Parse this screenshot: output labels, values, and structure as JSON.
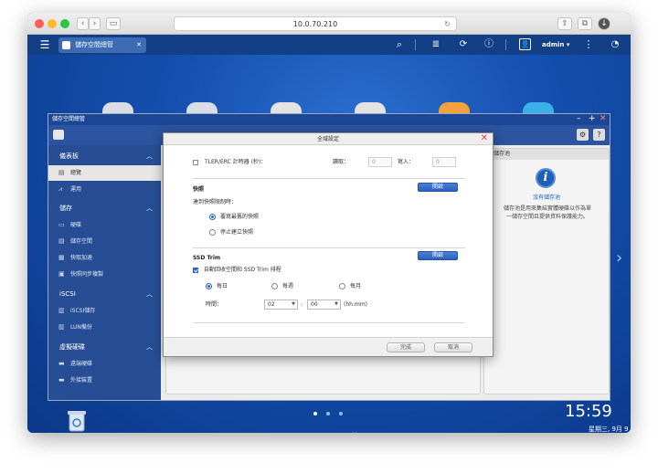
{
  "browser": {
    "url": "10.0.70.210"
  },
  "qts_toolbar": {
    "tab_label": "儲存空間總管",
    "user": "admin ▾"
  },
  "storage_manager": {
    "window_title": "儲存空間總管",
    "sidebar": {
      "sections": [
        {
          "label": "儀表板",
          "items": [
            "總覽",
            "運用"
          ]
        },
        {
          "label": "儲存",
          "items": [
            "硬碟",
            "儲存空間",
            "快取加速",
            "快照同步複製"
          ]
        },
        {
          "label": "iSCSI",
          "items": [
            "iSCSI儲存",
            "LUN備份"
          ]
        },
        {
          "label": "虛擬硬碟",
          "items": [
            "遠端硬碟",
            "外接裝置"
          ]
        }
      ],
      "active_item": "總覽"
    },
    "right_panel": {
      "header": "儲存池",
      "no_pool": "沒有儲存池",
      "info_line1": "儲存池是用來集結實體硬碟以作為單",
      "info_line2": "一儲存空間且提供資料保護能力。"
    }
  },
  "dialog": {
    "title": "全域設定",
    "tler_label": "TLER/ERC 計時器 (秒)：",
    "read_label": "讀取：",
    "write_label": "寫入：",
    "read_value": "0",
    "write_value": "0",
    "snapshot": {
      "heading": "快照",
      "status_button": "開啟",
      "limit_label": "達到快照限制時：",
      "option_overwrite": "覆寫最舊的快照",
      "option_stop": "停止建立快照"
    },
    "ssd_trim": {
      "heading": "SSD Trim",
      "status_button": "開啟",
      "auto_label": "自動回收空間和 SSD Trim 排程",
      "daily": "每日",
      "weekly": "每週",
      "monthly": "每月",
      "time_label": "時間：",
      "hour": "02",
      "minute": "00",
      "colon": ":",
      "format": "(hh:mm)"
    },
    "buttons": {
      "finish": "完成",
      "cancel": "取消"
    }
  },
  "desktop": {
    "time": "15:59",
    "date": "星期三, 9月 9 日"
  },
  "colors": {
    "qts_blue": "#133f86",
    "sidebar_blue": "#274e95",
    "accent": "#2b63c9",
    "close_red": "#e04848"
  }
}
